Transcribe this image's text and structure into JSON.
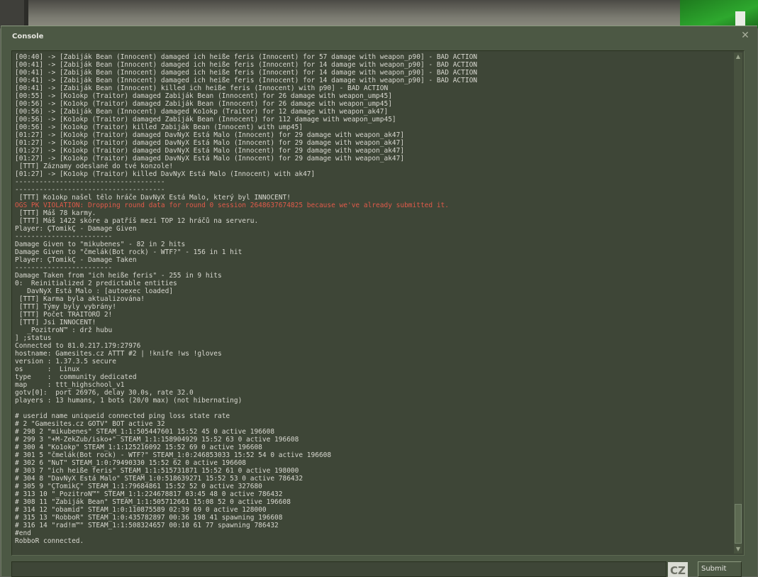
{
  "window": {
    "title": "Console",
    "close_label": "✕"
  },
  "log_lines": [
    {
      "text": "[00:40] -> [Zabiják Bean (Innocent) damaged ich heiße feris (Innocent) for 57 damage with weapon_p90] - BAD ACTION",
      "type": "normal"
    },
    {
      "text": "[00:41] -> [Zabiják Bean (Innocent) damaged ich heiße feris (Innocent) for 14 damage with weapon_p90] - BAD ACTION",
      "type": "normal"
    },
    {
      "text": "[00:41] -> [Zabiják Bean (Innocent) damaged ich heiße feris (Innocent) for 14 damage with weapon_p90] - BAD ACTION",
      "type": "normal"
    },
    {
      "text": "[00:41] -> [Zabiják Bean (Innocent) damaged ich heiße feris (Innocent) for 14 damage with weapon_p90] - BAD ACTION",
      "type": "normal"
    },
    {
      "text": "[00:41] -> [Zabiják Bean (Innocent) killed ich heiße feris (Innocent) with p90] - BAD ACTION",
      "type": "normal"
    },
    {
      "text": "[00:55] -> [Ko1okp (Traitor) damaged Zabiják Bean (Innocent) for 26 damage with weapon_ump45]",
      "type": "normal"
    },
    {
      "text": "[00:56] -> [Ko1okp (Traitor) damaged Zabiják Bean (Innocent) for 26 damage with weapon_ump45]",
      "type": "normal"
    },
    {
      "text": "[00:56] -> [Zabiják Bean (Innocent) damaged Ko1okp (Traitor) for 12 damage with weapon_ak47]",
      "type": "normal"
    },
    {
      "text": "[00:56] -> [Ko1okp (Traitor) damaged Zabiják Bean (Innocent) for 112 damage with weapon_ump45]",
      "type": "normal"
    },
    {
      "text": "[00:56] -> [Ko1okp (Traitor) killed Zabiják Bean (Innocent) with ump45]",
      "type": "normal"
    },
    {
      "text": "[01:27] -> [Ko1okp (Traitor) damaged DavNyX Está Malo (Innocent) for 29 damage with weapon_ak47]",
      "type": "normal"
    },
    {
      "text": "[01:27] -> [Ko1okp (Traitor) damaged DavNyX Está Malo (Innocent) for 29 damage with weapon_ak47]",
      "type": "normal"
    },
    {
      "text": "[01:27] -> [Ko1okp (Traitor) damaged DavNyX Está Malo (Innocent) for 29 damage with weapon_ak47]",
      "type": "normal"
    },
    {
      "text": "[01:27] -> [Ko1okp (Traitor) damaged DavNyX Está Malo (Innocent) for 29 damage with weapon_ak47]",
      "type": "normal"
    },
    {
      "text": " [TTT] Záznamy odeslané do tvé konzole!",
      "type": "normal"
    },
    {
      "text": "[01:27] -> [Ko1okp (Traitor) killed DavNyX Está Malo (Innocent) with ak47]",
      "type": "normal"
    },
    {
      "text": "-------------------------------------",
      "type": "normal"
    },
    {
      "text": "-------------------------------------",
      "type": "normal"
    },
    {
      "text": " [TTT] Ko1okp našel tělo hráče DavNyX Está Malo, který byl INNOCENT!",
      "type": "normal"
    },
    {
      "text": "OGS PK VIOLATION: Dropping round data for round 0 session 2648637674825 because we've already submitted it.",
      "type": "err"
    },
    {
      "text": " [TTT] Máš 78 karmy.",
      "type": "normal"
    },
    {
      "text": " [TTT] Máš 1422 skóre a patříš mezi TOP 12 hráčů na serveru.",
      "type": "normal"
    },
    {
      "text": "Player: ÇTomikÇ - Damage Given",
      "type": "normal"
    },
    {
      "text": "------------------------",
      "type": "normal"
    },
    {
      "text": "Damage Given to \"mikubenes\" - 82 in 2 hits",
      "type": "normal"
    },
    {
      "text": "Damage Given to \"čmelák(Bot rock) - WTF?\" - 156 in 1 hit",
      "type": "normal"
    },
    {
      "text": "Player: ÇTomikÇ - Damage Taken",
      "type": "normal"
    },
    {
      "text": "------------------------",
      "type": "normal"
    },
    {
      "text": "Damage Taken from \"ich heiße feris\" - 255 in 9 hits",
      "type": "normal"
    },
    {
      "text": "0:  Reinitialized 2 predictable entities",
      "type": "normal"
    },
    {
      "text": "   DavNyX Está Malo : [autoexec loaded]",
      "type": "normal"
    },
    {
      "text": " [TTT] Karma byla aktualizována!",
      "type": "normal"
    },
    {
      "text": " [TTT] Týmy byly vybrány!",
      "type": "normal"
    },
    {
      "text": " [TTT] Počet TRAITORŮ 2!",
      "type": "normal"
    },
    {
      "text": " [TTT] Jsi INNOCENT!",
      "type": "normal"
    },
    {
      "text": "   _PozitroN™ : drž hubu",
      "type": "normal"
    },
    {
      "text": "] ;status",
      "type": "normal"
    },
    {
      "text": "Connected to 81.0.217.179:27976",
      "type": "normal"
    },
    {
      "text": "hostname: Gamesites.cz ATTT #2 | !knife !ws !gloves",
      "type": "normal"
    },
    {
      "text": "version : 1.37.3.5 secure",
      "type": "normal"
    },
    {
      "text": "os      :  Linux",
      "type": "normal"
    },
    {
      "text": "type    :  community dedicated",
      "type": "normal"
    },
    {
      "text": "map     : ttt_highschool_v1",
      "type": "normal"
    },
    {
      "text": "gotv[0]:  port 26976, delay 30.0s, rate 32.0",
      "type": "normal"
    },
    {
      "text": "players : 13 humans, 1 bots (20/0 max) (not hibernating)",
      "type": "normal"
    },
    {
      "text": "",
      "type": "normal"
    },
    {
      "text": "# userid name uniqueid connected ping loss state rate",
      "type": "normal"
    },
    {
      "text": "# 2 \"Gamesites.cz GOTV\" BOT active 32",
      "type": "normal"
    },
    {
      "text": "# 298 2 \"mikubenes\" STEAM_1:1:505447601 15:52 45 0 active 196608",
      "type": "normal"
    },
    {
      "text": "# 299 3 \"+M-ZekŽub/isko+\" STEAM_1:1:158904929 15:52 63 0 active 196608",
      "type": "normal"
    },
    {
      "text": "# 300 4 \"Ko1okp\" STEAM_1:1:125216092 15:52 69 0 active 196608",
      "type": "normal"
    },
    {
      "text": "# 301 5 \"čmelák(Bot rock) - WTF?\" STEAM_1:0:246853033 15:52 54 0 active 196608",
      "type": "normal"
    },
    {
      "text": "# 302 6 \"NuT\" STEAM_1:0:79490330 15:52 62 0 active 196608",
      "type": "normal"
    },
    {
      "text": "# 303 7 \"ich heiße feris\" STEAM_1:1:515731871 15:52 61 0 active 198000",
      "type": "normal"
    },
    {
      "text": "# 304 8 \"DavNyX Está Malo\" STEAM_1:0:518639271 15:52 53 0 active 786432",
      "type": "normal"
    },
    {
      "text": "# 305 9 \"ÇTomikÇ\" STEAM_1:1:79684861 15:52 52 0 active 327680",
      "type": "normal"
    },
    {
      "text": "# 313 10 \"_PozitroN™\" STEAM_1:1:224678817 03:45 48 0 active 786432",
      "type": "normal"
    },
    {
      "text": "# 308 11 \"Zabiják Bean\" STEAM_1:1:505712661 15:08 52 0 active 196608",
      "type": "normal"
    },
    {
      "text": "# 314 12 \"obamid\" STEAM_1:0:110875589 02:39 69 0 active 128000",
      "type": "normal"
    },
    {
      "text": "# 315 13 \"RobboR\" STEAM_1:0:435782897 00:36 198 41 spawning 196608",
      "type": "normal"
    },
    {
      "text": "# 316 14 \"rad!m™\" STEAM_1:1:508324657 00:10 61 77 spawning 786432",
      "type": "normal"
    },
    {
      "text": "#end",
      "type": "normal"
    },
    {
      "text": "RobboR connected.",
      "type": "normal"
    }
  ],
  "input": {
    "value": "",
    "ime_label": "CZ"
  },
  "submit_label": "Submit",
  "colors": {
    "panel": "#4c5844",
    "log_bg": "#3e4637",
    "text": "#d8d8d0",
    "error_text": "#e05a4a"
  },
  "icons": {
    "close": "close-icon",
    "scroll_up": "arrow-up-icon",
    "scroll_down": "arrow-down-icon"
  }
}
